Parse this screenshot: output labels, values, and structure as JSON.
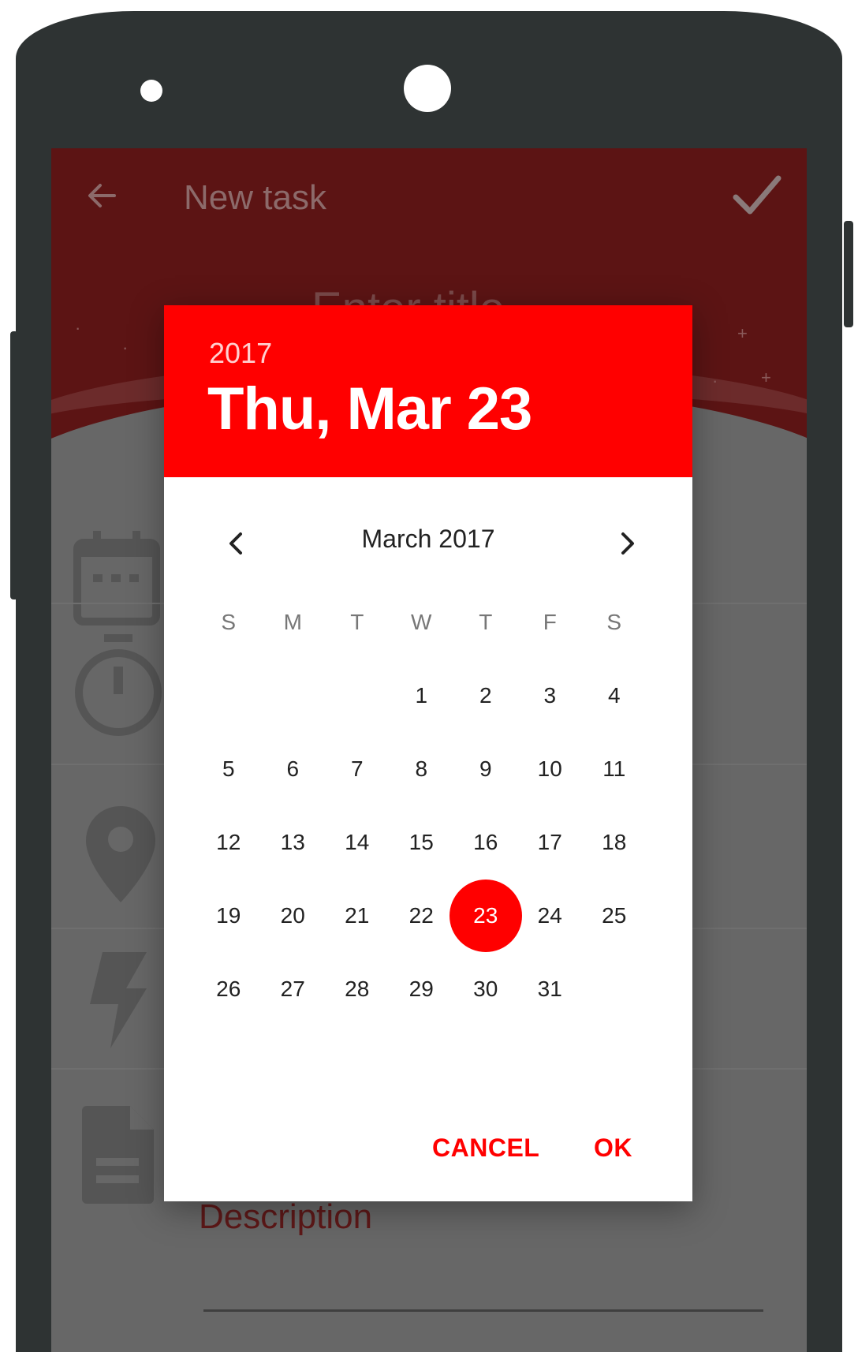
{
  "app_bar": {
    "title": "New task",
    "back_icon": "arrow-left-icon",
    "confirm_icon": "check-icon",
    "title_placeholder": "Enter title"
  },
  "form": {
    "description_label": "Description"
  },
  "date_picker": {
    "header_year": "2017",
    "header_date": "Thu, Mar 23",
    "month_label": "March 2017",
    "weekdays": [
      "S",
      "M",
      "T",
      "W",
      "T",
      "F",
      "S"
    ],
    "weeks": [
      [
        "",
        "",
        "",
        "1",
        "2",
        "3",
        "4"
      ],
      [
        "5",
        "6",
        "7",
        "8",
        "9",
        "10",
        "11"
      ],
      [
        "12",
        "13",
        "14",
        "15",
        "16",
        "17",
        "18"
      ],
      [
        "19",
        "20",
        "21",
        "22",
        "23",
        "24",
        "25"
      ],
      [
        "26",
        "27",
        "28",
        "29",
        "30",
        "31",
        ""
      ]
    ],
    "selected_day": "23",
    "cancel_label": "CANCEL",
    "ok_label": "OK",
    "accent_color": "#ff0000"
  }
}
